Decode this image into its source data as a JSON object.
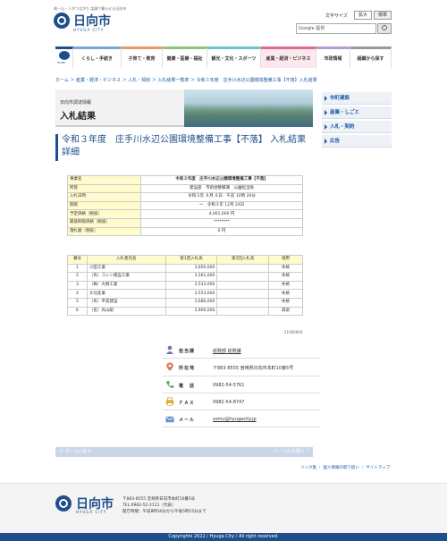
{
  "header": {
    "catchphrase": "海・山・人がつながり 笑顔で暮らせる日向市",
    "brand": "日向市",
    "brand_en": "HYUGA CITY",
    "font_size_label": "文字サイズ",
    "font_size_large": "拡大",
    "font_size_standard": "標準",
    "search_text": "Google 提供"
  },
  "nav": {
    "home_label": "HOME",
    "items": [
      {
        "label": "くらし・手続き",
        "color": "#7aa7d8"
      },
      {
        "label": "子育て・教育",
        "color": "#e89a6a"
      },
      {
        "label": "健康・医療・福祉",
        "color": "#8cc57a"
      },
      {
        "label": "観光・文化・スポーツ",
        "color": "#6cc3c9"
      },
      {
        "label": "産業・経済・ビジネス",
        "color": "#e06a8c"
      },
      {
        "label": "市政情報",
        "color": "#b99ad8"
      },
      {
        "label": "組織から探す",
        "color": "#999999"
      }
    ]
  },
  "breadcrumb": "ホーム ＞ 産業・経済・ビジネス ＞ 入札・契約 ＞ 入札結果一覧表 ＞ 令和３年度　庄手川水辺公園環境整備工事【不落】入札結果",
  "banner": {
    "subtitle": "日向市調達情報",
    "title": "入札結果"
  },
  "page_title": "令和３年度　庄手川水辺公園環境整備工事【不落】 入札結果 詳細",
  "side_menu": [
    "市町建設",
    "産業・しごと",
    "入札・契約",
    "広告"
  ],
  "info_table": [
    {
      "label": "事業名",
      "value": "令和３年度　庄手川水辺公園環境整備工事【不落】"
    },
    {
      "label": "所管",
      "value": "建設部　市街地整備課　公園担当係"
    },
    {
      "label": "入札日時",
      "value": "令和３年 ９月 ８日　午前 10時 20分"
    },
    {
      "label": "期限",
      "value": "〜　令和３年 12月 24日"
    },
    {
      "label": "予定価格（税抜）",
      "value": "4,061,000 円"
    },
    {
      "label": "最低制限価格（税抜）",
      "value": "********"
    },
    {
      "label": "落札額（税抜）",
      "value": "0 円"
    }
  ],
  "bid_table": {
    "headers": [
      "番号",
      "入札者氏名",
      "第1回入札高",
      "第2回入札高",
      "適用"
    ],
    "rows": [
      [
        "1",
        "小田工業",
        "3,600,000",
        "",
        "失格"
      ],
      [
        "2",
        "（有）コニシ建設工業",
        "3,561,000",
        "",
        "失格"
      ],
      [
        "3",
        "（株）大樹工業",
        "3,533,000",
        "",
        "失格"
      ],
      [
        "4",
        "大北産業",
        "3,553,000",
        "",
        "失格"
      ],
      [
        "5",
        "（有）平成建設",
        "3,686,000",
        "",
        "失格"
      ],
      [
        "6",
        "（名）光山組",
        "3,900,000",
        "",
        "辞退"
      ]
    ]
  },
  "code_note": "21090904",
  "contact": {
    "dept_label": "担当課",
    "dept_value": "総務部 総務課",
    "address_label": "所在地",
    "address_value": "〒883-8555 宮崎県日向市本町10番5号",
    "tel_label": "電　話",
    "tel_value": "0982-54-5761",
    "fax_label": "ＦＡＸ",
    "fax_value": "0982-54-8747",
    "mail_label": "メール",
    "mail_value": "somu@hyugacity.jp"
  },
  "bottom": {
    "back_home": "＜ ホームに戻る",
    "page_top": "ページの先頭へ ^",
    "links": "リンク集 ｜ 個人情報の取り扱い ｜ サイトマップ"
  },
  "footer": {
    "brand": "日向市",
    "brand_en": "HYUGA CITY",
    "address": "〒883-8555 宮崎県日向市本町10番5号",
    "tel": "TEL:0982-52-2111（代表）",
    "hours": "開庁時間：午前8時30分から午後5時15分まで",
    "copyright": "Copyrights 2022 / Hyuga City / All right reserved."
  }
}
